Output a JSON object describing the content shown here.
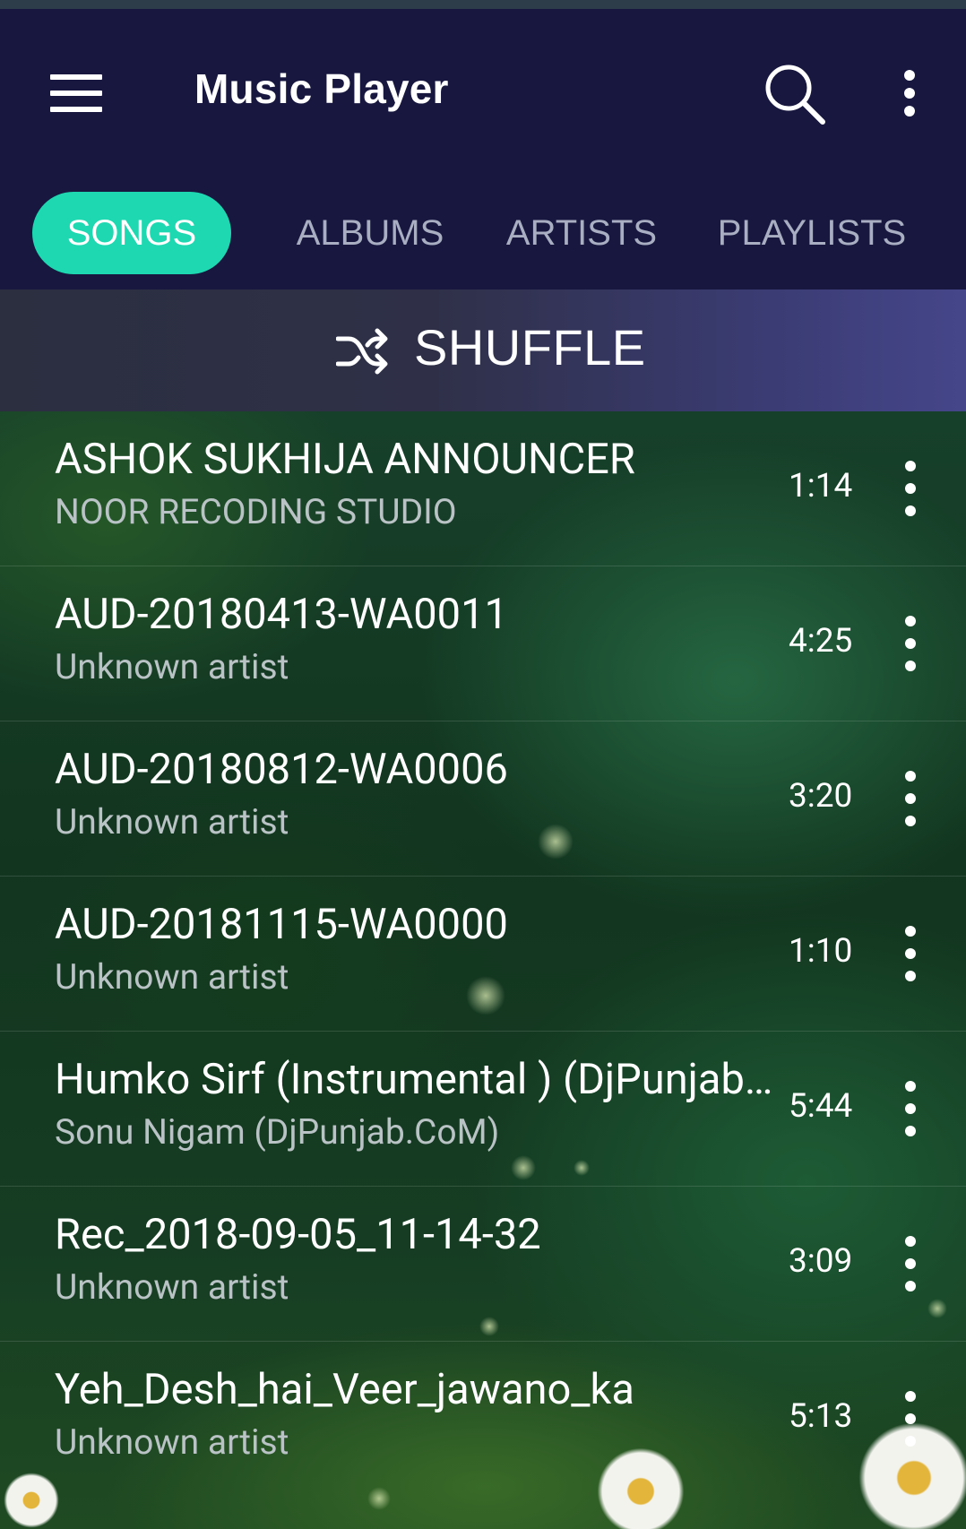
{
  "toolbar": {
    "title": "Music Player",
    "menu_icon": "hamburger-menu-icon",
    "search_icon": "search-icon",
    "overflow_icon": "more-vert-icon"
  },
  "tabs": [
    {
      "label": "SONGS",
      "active": true
    },
    {
      "label": "ALBUMS",
      "active": false
    },
    {
      "label": "ARTISTS",
      "active": false
    },
    {
      "label": "PLAYLISTS",
      "active": false
    }
  ],
  "shuffle": {
    "icon": "shuffle-icon",
    "label": "SHUFFLE"
  },
  "songs": [
    {
      "title": "ASHOK SUKHIJA ANNOUNCER",
      "artist": "NOOR RECODING STUDIO",
      "duration": "1:14"
    },
    {
      "title": "AUD-20180413-WA0011",
      "artist": "Unknown artist",
      "duration": "4:25"
    },
    {
      "title": "AUD-20180812-WA0006",
      "artist": "Unknown artist",
      "duration": "3:20"
    },
    {
      "title": "AUD-20181115-WA0000",
      "artist": "Unknown artist",
      "duration": "1:10"
    },
    {
      "title": "Humko Sirf (Instrumental ) (DjPunjab.CoM)",
      "artist": "Sonu Nigam (DjPunjab.CoM)",
      "duration": "5:44"
    },
    {
      "title": "Rec_2018-09-05_11-14-32",
      "artist": "Unknown artist",
      "duration": "3:09"
    },
    {
      "title": "Yeh_Desh_hai_Veer_jawano_ka",
      "artist": "Unknown artist",
      "duration": "5:13"
    }
  ],
  "colors": {
    "header_bg": "#17173f",
    "active_tab": "#1dd8b0",
    "inactive_tab_text": "#a9aec2",
    "artist_text": "#b9c2c4"
  }
}
